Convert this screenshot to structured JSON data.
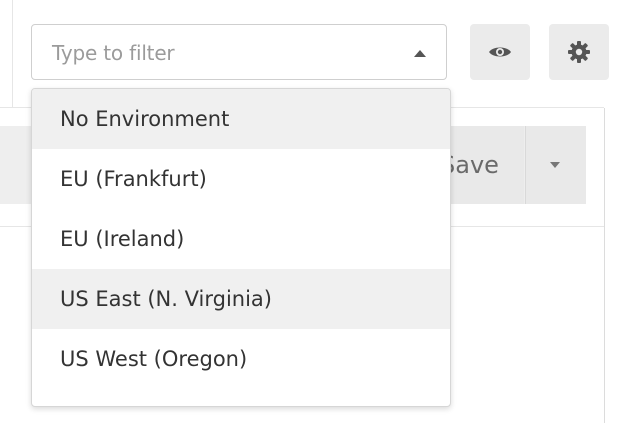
{
  "filter": {
    "placeholder": "Type to filter"
  },
  "toolbar": {
    "save_label": "Save"
  },
  "dropdown": {
    "options": [
      {
        "label": "No Environment",
        "highlighted": true
      },
      {
        "label": "EU (Frankfurt)",
        "highlighted": false
      },
      {
        "label": "EU (Ireland)",
        "highlighted": false
      },
      {
        "label": "US East (N. Virginia)",
        "highlighted": true
      },
      {
        "label": "US West (Oregon)",
        "highlighted": false
      }
    ]
  },
  "icons": {
    "view": "eye-icon",
    "settings": "gear-icon",
    "filter_caret": "caret-up-icon",
    "save_menu": "caret-down-icon"
  }
}
